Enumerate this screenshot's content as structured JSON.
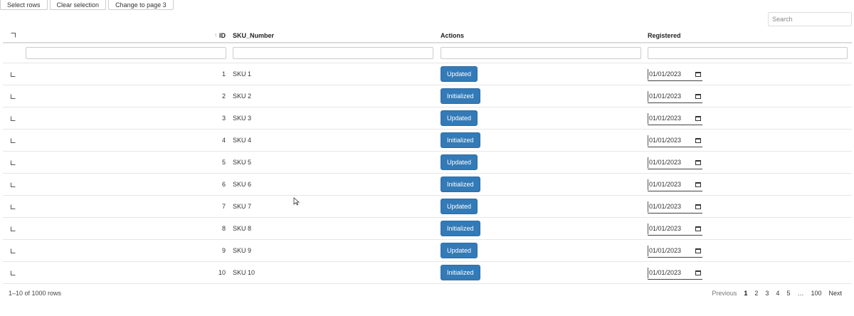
{
  "toolbar": {
    "select_rows": "Select rows",
    "clear_selection": "Clear selection",
    "change_page": "Change to page 3"
  },
  "search": {
    "placeholder": "Search"
  },
  "columns": {
    "id": "ID",
    "sku": "SKU_Number",
    "actions": "Actions",
    "registered": "Registered"
  },
  "sort_icon": "sort-ascending-icon",
  "rows": [
    {
      "id": "1",
      "sku": "SKU 1",
      "action": "Updated",
      "date": "01/01/2023"
    },
    {
      "id": "2",
      "sku": "SKU 2",
      "action": "Initialized",
      "date": "01/01/2023"
    },
    {
      "id": "3",
      "sku": "SKU 3",
      "action": "Updated",
      "date": "01/01/2023"
    },
    {
      "id": "4",
      "sku": "SKU 4",
      "action": "Initialized",
      "date": "01/01/2023"
    },
    {
      "id": "5",
      "sku": "SKU 5",
      "action": "Updated",
      "date": "01/01/2023"
    },
    {
      "id": "6",
      "sku": "SKU 6",
      "action": "Initialized",
      "date": "01/01/2023"
    },
    {
      "id": "7",
      "sku": "SKU 7",
      "action": "Updated",
      "date": "01/01/2023"
    },
    {
      "id": "8",
      "sku": "SKU 8",
      "action": "Initialized",
      "date": "01/01/2023"
    },
    {
      "id": "9",
      "sku": "SKU 9",
      "action": "Updated",
      "date": "01/01/2023"
    },
    {
      "id": "10",
      "sku": "SKU 10",
      "action": "Initialized",
      "date": "01/01/2023"
    }
  ],
  "footer": {
    "info": "1–10 of 1000 rows",
    "previous": "Previous",
    "pages": [
      "1",
      "2",
      "3",
      "4",
      "5",
      "…",
      "100"
    ],
    "next": "Next"
  },
  "colors": {
    "button": "#337ab7"
  }
}
